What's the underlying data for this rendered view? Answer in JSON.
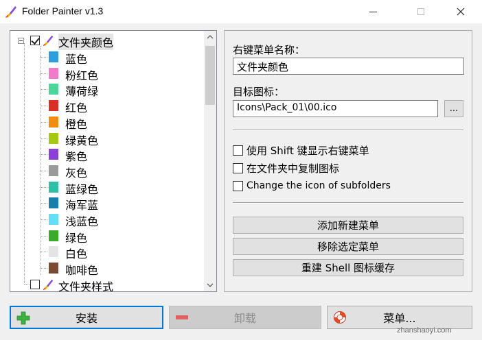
{
  "window": {
    "title": "Folder Painter v1.3",
    "minimize_icon": "minimize-icon",
    "maximize_icon": "maximize-icon",
    "close_icon": "close-icon"
  },
  "tree": {
    "root1": {
      "label": "文件夹颜色",
      "checked": true,
      "icon": "brush-icon"
    },
    "colors": [
      {
        "label": "蓝色",
        "color": "#2e9de0"
      },
      {
        "label": "粉红色",
        "color": "#f27ac9"
      },
      {
        "label": "薄荷绿",
        "color": "#4ed69a"
      },
      {
        "label": "红色",
        "color": "#d93025"
      },
      {
        "label": "橙色",
        "color": "#ef8c12"
      },
      {
        "label": "绿黄色",
        "color": "#a6c813"
      },
      {
        "label": "紫色",
        "color": "#8a3fd6"
      },
      {
        "label": "灰色",
        "color": "#9a9a9a"
      },
      {
        "label": "蓝绿色",
        "color": "#2dc0a6"
      },
      {
        "label": "海军蓝",
        "color": "#1a7fa8"
      },
      {
        "label": "浅蓝色",
        "color": "#62dff3"
      },
      {
        "label": "绿色",
        "color": "#3aaa2e"
      },
      {
        "label": "白色",
        "color": "#e4e4e4"
      },
      {
        "label": "咖啡色",
        "color": "#7a4a33"
      }
    ],
    "root2": {
      "label": "文件夹样式",
      "checked": false,
      "icon": "brush-icon"
    }
  },
  "settings": {
    "menu_name_label": "右键菜单名称：",
    "menu_name_value": "文件夹颜色",
    "target_icon_label": "目标图标：",
    "target_icon_value": "Icons\\Pack_01\\00.ico",
    "browse_label": "...",
    "options": [
      {
        "label": "使用 Shift 键显示右键菜单",
        "checked": false
      },
      {
        "label": "在文件夹中复制图标",
        "checked": false
      },
      {
        "label": "Change the icon of subfolders",
        "checked": false
      }
    ],
    "actions": {
      "add_menu": "添加新建菜单",
      "remove_menu": "移除选定菜单",
      "rebuild_cache": "重建 Shell 图标缓存"
    }
  },
  "bottom": {
    "install": "安装",
    "uninstall": "卸载",
    "menu": "菜单..."
  },
  "watermark": "zhanshaoyi.com",
  "colors": {
    "accent": "#0078d7",
    "install_icon": "#3cb043",
    "uninstall_icon": "#e06060",
    "menu_icon": "#e84c1c"
  }
}
